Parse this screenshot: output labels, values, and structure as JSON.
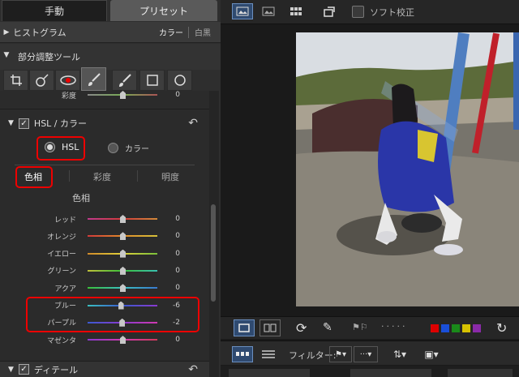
{
  "tabs": {
    "manual": "手動",
    "preset": "プリセット"
  },
  "histogram": {
    "title": "ヒストグラム",
    "color": "カラー",
    "bw": "白黒"
  },
  "local": {
    "title": "部分調整ツール"
  },
  "saturation": {
    "label": "彩度",
    "value": "0"
  },
  "hsl": {
    "title": "HSL / カラー",
    "radio_hsl": "HSL",
    "radio_color": "カラー",
    "sub_hue": "色相",
    "sub_sat": "彩度",
    "sub_light": "明度",
    "section": "色相"
  },
  "sliders": [
    {
      "label": "レッド",
      "value": "0",
      "level": 0
    },
    {
      "label": "オレンジ",
      "value": "0",
      "level": 0
    },
    {
      "label": "イエロー",
      "value": "0",
      "level": 0
    },
    {
      "label": "グリーン",
      "value": "0",
      "level": 0
    },
    {
      "label": "アクア",
      "value": "0",
      "level": 0
    },
    {
      "label": "ブルー",
      "value": "-6",
      "level": -6
    },
    {
      "label": "パープル",
      "value": "-2",
      "level": -2
    },
    {
      "label": "マゼンタ",
      "value": "0",
      "level": 0
    }
  ],
  "detail": {
    "title": "ディテール"
  },
  "toolbar": {
    "soft_proof": "ソフト校正",
    "filter": "フィルター:"
  },
  "colors": {
    "red": "#e00000",
    "labels": [
      "#dd0000",
      "#1a4fd8",
      "#1a8a1a",
      "#d6c100",
      "#8a2aa8"
    ]
  }
}
